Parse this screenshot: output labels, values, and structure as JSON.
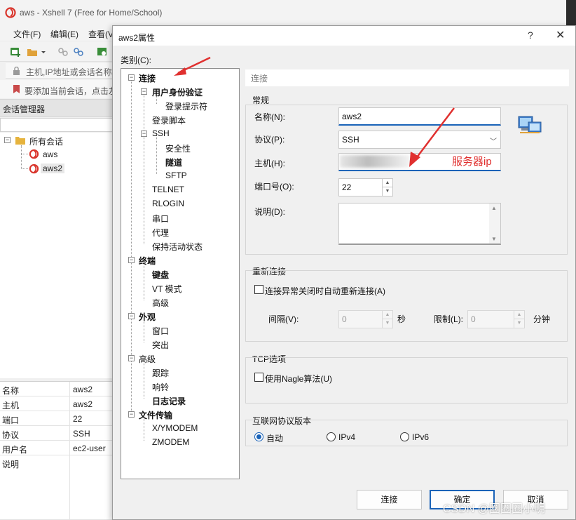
{
  "bg": {
    "title": "aws - Xshell 7 (Free for Home/School)",
    "menu": [
      "文件(F)",
      "编辑(E)",
      "查看(V"
    ],
    "address_placeholder": "主机,IP地址或会话名称",
    "hint": "要添加当前会话，点击左",
    "session_manager": "会话管理器",
    "tree": {
      "root": "所有会话",
      "items": [
        "aws",
        "aws2"
      ]
    },
    "props": [
      {
        "k": "名称",
        "v": "aws2"
      },
      {
        "k": "主机",
        "v": "aws2"
      },
      {
        "k": "端口",
        "v": "22"
      },
      {
        "k": "协议",
        "v": "SSH"
      },
      {
        "k": "用户名",
        "v": "ec2-user"
      },
      {
        "k": "说明",
        "v": ""
      }
    ]
  },
  "dialog": {
    "title": "aws2属性",
    "help": "?",
    "close": "✕",
    "category_label": "类别(C):",
    "tree": [
      "连接",
      "用户身份验证",
      "登录提示符",
      "登录脚本",
      "SSH",
      "安全性",
      "隧道",
      "SFTP",
      "TELNET",
      "RLOGIN",
      "串口",
      "代理",
      "保持活动状态",
      "终端",
      "键盘",
      "VT 模式",
      "高级",
      "外观",
      "窗口",
      "突出",
      "高级",
      "跟踪",
      "响铃",
      "日志记录",
      "文件传输",
      "X/YMODEM",
      "ZMODEM"
    ],
    "section_title": "连接",
    "general": {
      "label": "常规",
      "name_label": "名称(N):",
      "name_value": "aws2",
      "protocol_label": "协议(P):",
      "protocol_value": "SSH",
      "host_label": "主机(H):",
      "port_label": "端口号(O):",
      "port_value": "22",
      "desc_label": "说明(D):"
    },
    "reconnect": {
      "label": "重新连接",
      "check_label": "连接异常关闭时自动重新连接(A)",
      "interval_label": "间隔(V):",
      "interval_value": "0",
      "sec": "秒",
      "limit_label": "限制(L):",
      "limit_value": "0",
      "min": "分钟"
    },
    "tcp": {
      "label": "TCP选项",
      "nagle_label": "使用Nagle算法(U)"
    },
    "ipver": {
      "label": "互联网协议版本",
      "auto": "自动",
      "ipv4": "IPv4",
      "ipv6": "IPv6"
    },
    "buttons": {
      "connect": "连接",
      "ok": "确定",
      "cancel": "取消"
    }
  },
  "annotation": {
    "text": "服务器ip",
    "color": "#e0302f"
  },
  "watermark": "CSDN @圈圈圈小明",
  "colors": {
    "accent": "#1a63b8",
    "annotation": "#e0302f"
  }
}
